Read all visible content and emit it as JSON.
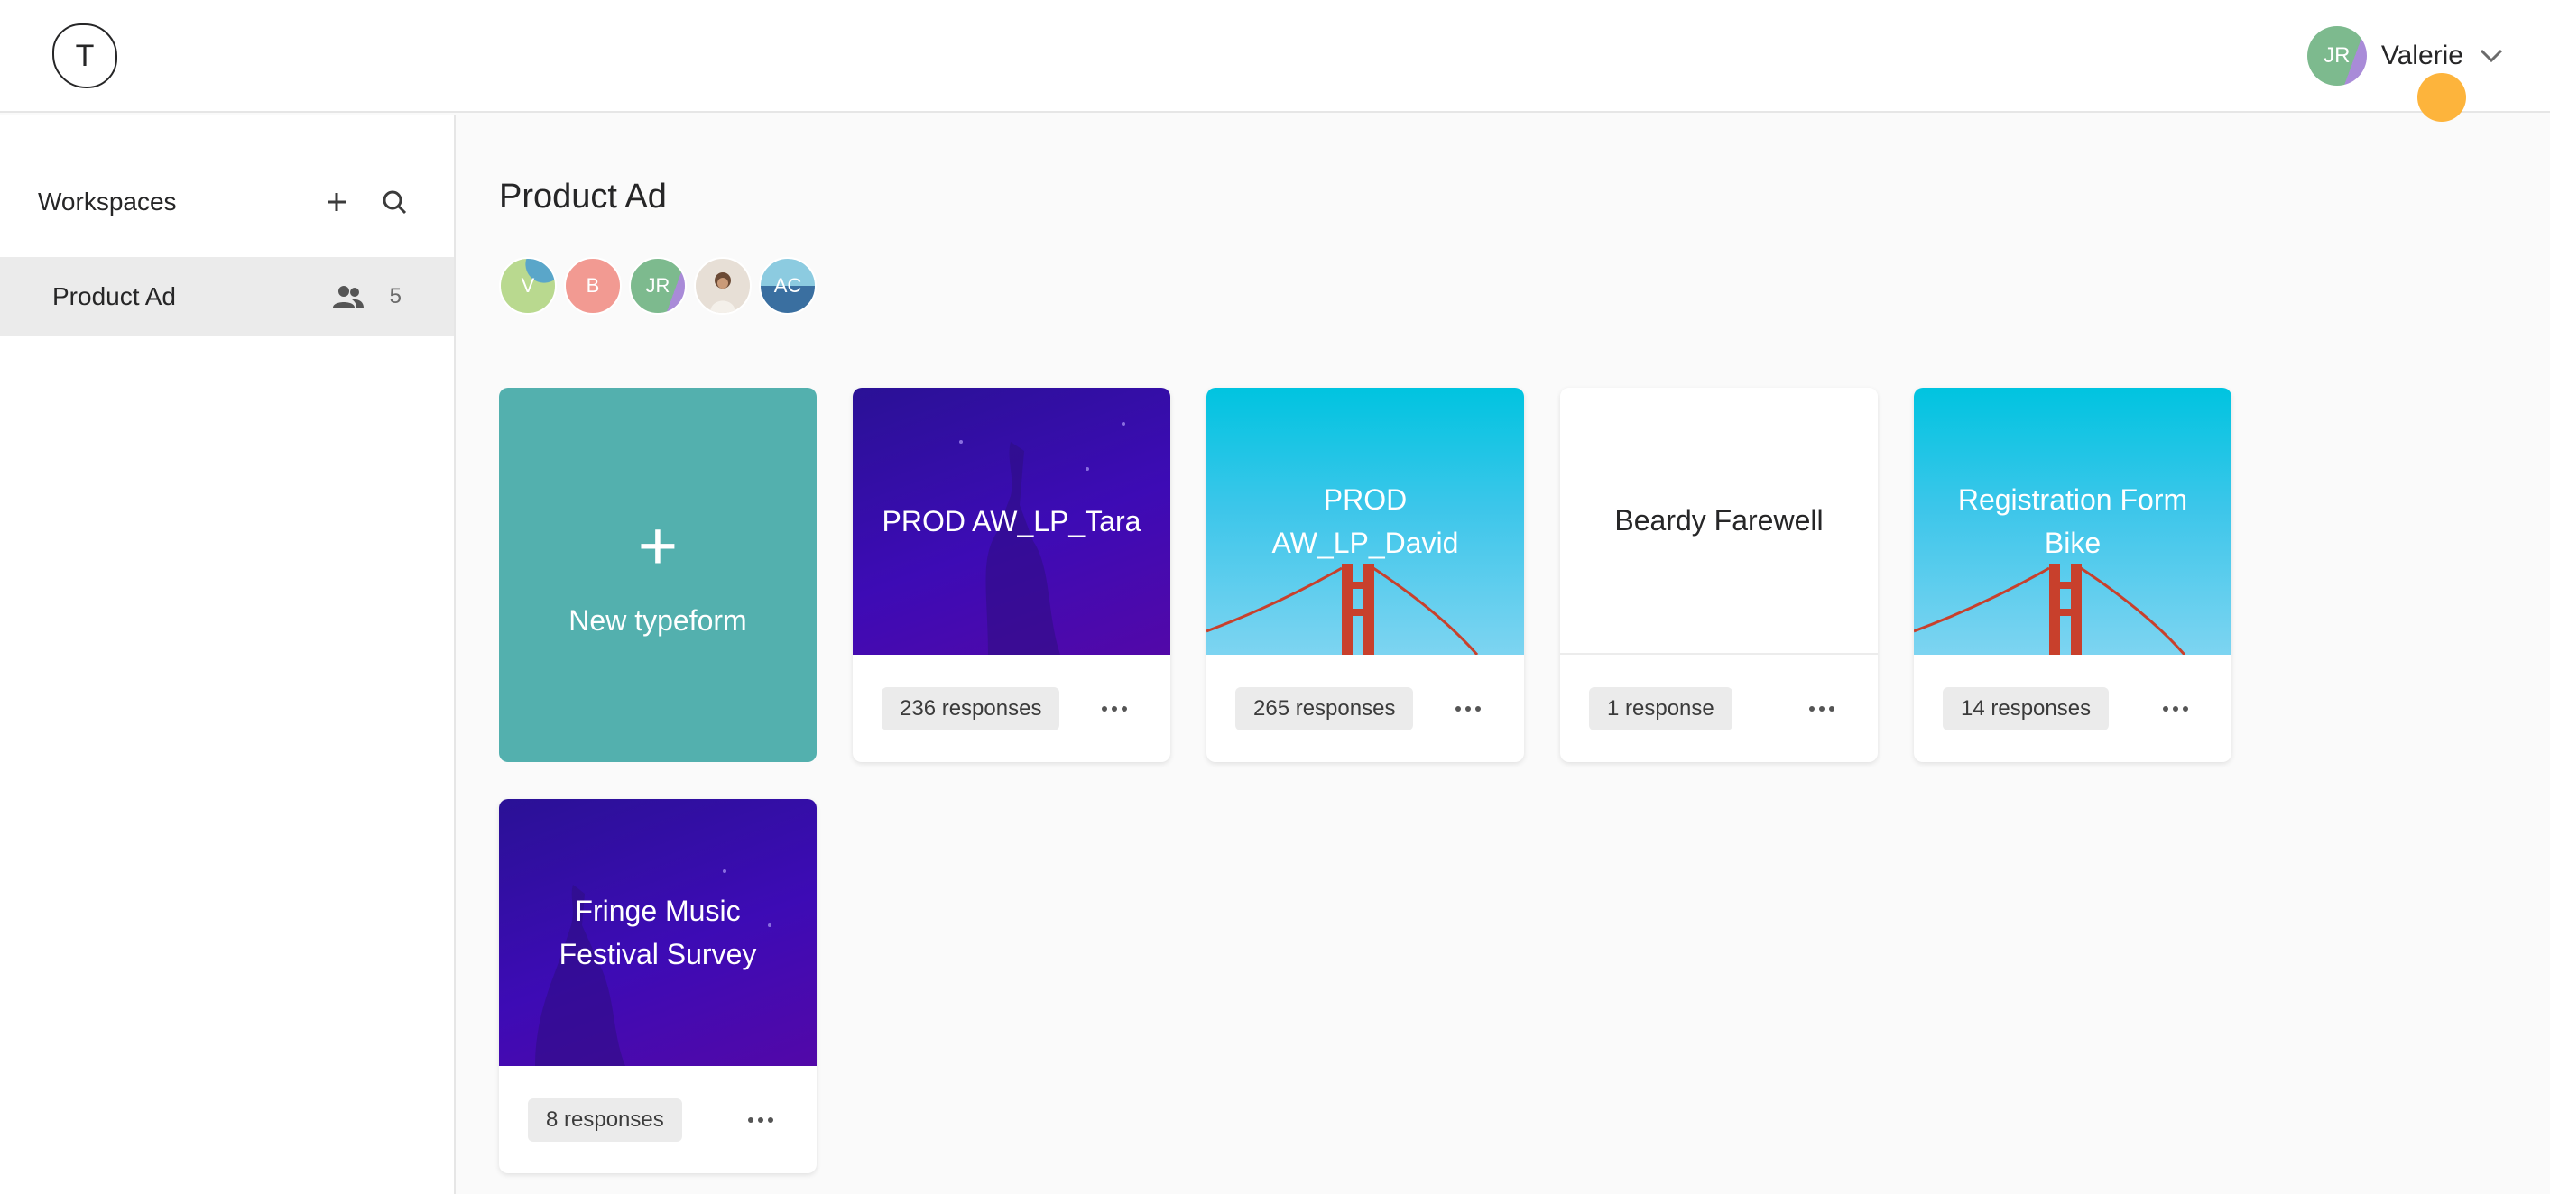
{
  "logo": {
    "letter": "T"
  },
  "user": {
    "initials": "JR",
    "name": "Valerie"
  },
  "sidebar": {
    "title": "Workspaces",
    "items": [
      {
        "label": "Product Ad",
        "member_count": "5"
      }
    ]
  },
  "main": {
    "title": "Product Ad",
    "members": [
      {
        "initials": "V",
        "color": "#b9d98f"
      },
      {
        "initials": "B",
        "color": "#f29a92"
      },
      {
        "initials": "JR",
        "color": "#7dba8e"
      },
      {
        "initials": "",
        "color": "#e7dfd6"
      },
      {
        "initials": "AC",
        "color": "#5aa6c9"
      }
    ],
    "new_form": {
      "plus": "+",
      "label": "New typeform"
    },
    "forms": [
      {
        "title": "PROD AW_LP_Tara",
        "responses": "236 responses",
        "theme": "purple"
      },
      {
        "title": "PROD AW_LP_David",
        "responses": "265 responses",
        "theme": "sky"
      },
      {
        "title": "Beardy Farewell",
        "responses": "1 response",
        "theme": "white"
      },
      {
        "title": "Registration Form Bike",
        "responses": "14 responses",
        "theme": "sky"
      },
      {
        "title": "Fringe Music Festival Survey",
        "responses": "8 responses",
        "theme": "purple"
      }
    ]
  },
  "colors": {
    "accent": "#53b0ae",
    "cursor": "#fdb43c"
  }
}
